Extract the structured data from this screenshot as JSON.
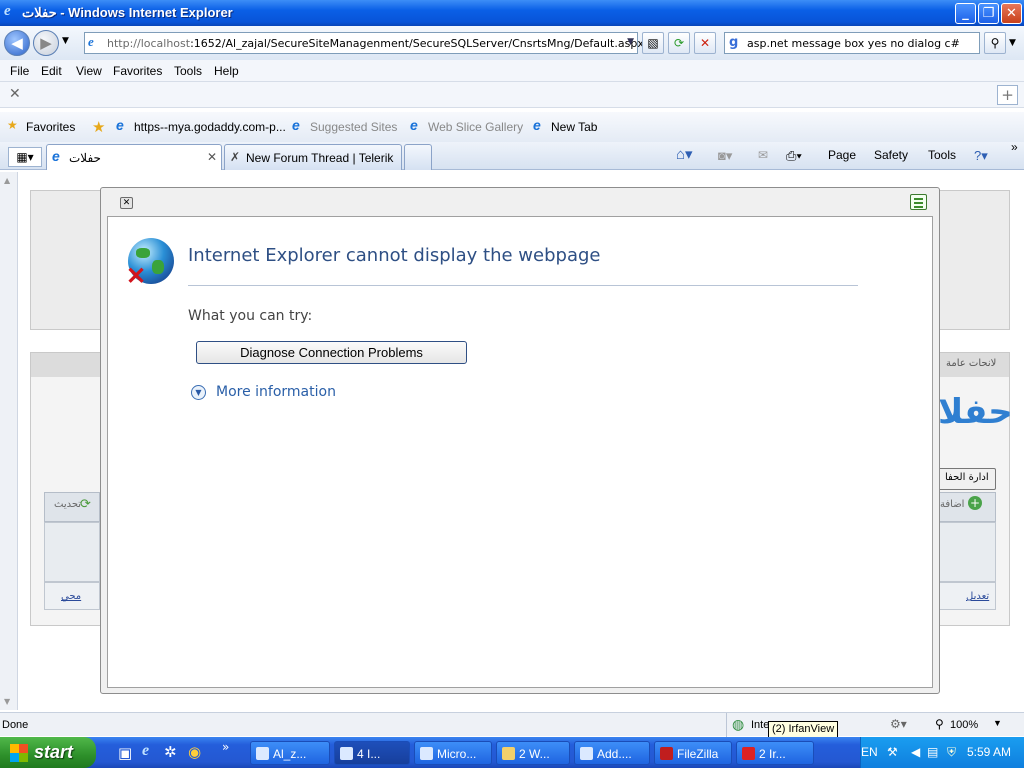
{
  "window": {
    "title": "حفلات - Windows Internet Explorer"
  },
  "address": {
    "url_host": "http://localhost",
    "url_rest": ":1652/Al_zajal/SecureSiteManagenment/SecureSQLServer/CnsrtsMng/Default.aspx"
  },
  "search": {
    "query": "asp.net message box yes no dialog c#"
  },
  "menu": [
    "File",
    "Edit",
    "View",
    "Favorites",
    "Tools",
    "Help"
  ],
  "favorites": {
    "label": "Favorites",
    "items": [
      "https--mya.godaddy.com-p...",
      "Suggested Sites",
      "Web Slice Gallery",
      "New Tab"
    ]
  },
  "tabs": [
    {
      "label": "حفلات"
    },
    {
      "label": "New Forum Thread | Telerik"
    }
  ],
  "commands": [
    "Page",
    "Safety",
    "Tools"
  ],
  "error": {
    "title": "Internet Explorer cannot display the webpage",
    "try_label": "What you can try:",
    "button": "Diagnose Connection Problems",
    "more": "More information"
  },
  "background": {
    "tab_label": "لانحات عامة",
    "heading": "حفلا",
    "button": "ادارة الحفا",
    "add": "اضافة",
    "refresh": "تحديث",
    "edit_link": "تعديل",
    "delete_link": "محي"
  },
  "status": {
    "text": "Done",
    "zone": "Inte",
    "zoom": "100%",
    "tooltip": "(2) IrfanView"
  },
  "taskbar": {
    "start": "start",
    "buttons": [
      "Al_z...",
      "4 I...",
      "Micro...",
      "2 W...",
      "Add....",
      "FileZilla",
      "2 Ir..."
    ],
    "lang": "EN",
    "time": "5:59 AM"
  }
}
